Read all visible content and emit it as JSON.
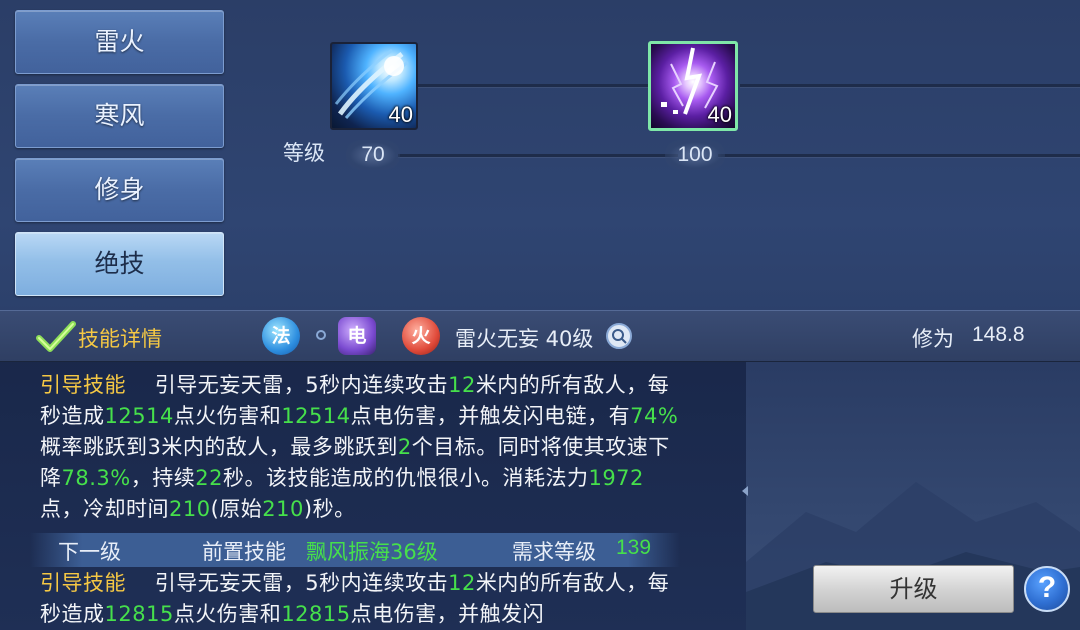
{
  "tabs": [
    {
      "label": "雷火",
      "active": false
    },
    {
      "label": "寒风",
      "active": false
    },
    {
      "label": "修身",
      "active": false
    },
    {
      "label": "绝技",
      "active": true
    }
  ],
  "skill_tree": {
    "level_label": "等级",
    "skills": [
      {
        "icon": "lightning-comet-skill-icon",
        "level": "40",
        "required_level": "70"
      },
      {
        "icon": "purple-lightning-skill-icon",
        "level": "40",
        "required_level": "100",
        "selected": true
      }
    ]
  },
  "header": {
    "title": "技能详情",
    "elements": [
      "法",
      "电",
      "火"
    ],
    "skill_name": "雷火无妄 40级",
    "cultivation_label": "修为",
    "cultivation_value": "148.8"
  },
  "current": {
    "type": "引导技能",
    "p1": "引导无妄天雷，5秒内连续攻击",
    "v1": "12",
    "p2": "米内的所有敌人，每秒造成",
    "v2": "12514",
    "p3": "点火伤害和",
    "v3": "12514",
    "p4": "点电伤害，并触发闪电链，有",
    "v4": "74%",
    "p5": "概率跳跃到3米内的敌人，最多跳跃到",
    "v5": "2",
    "p6": "个目标。同时将使其攻速下降",
    "v6": "78.3%",
    "p7": "，持续",
    "v7": "22",
    "p8": "秒。该技能造成的仇恨很小。消耗法力",
    "v8": "1972",
    "p9": "点，冷却时间",
    "v9": "210",
    "p10": "(原始",
    "v10": "210",
    "p11": ")秒。"
  },
  "next": {
    "label": "下一级",
    "prereq_label": "前置技能",
    "prereq_value": "飘风振海36级",
    "req_label": "需求等级",
    "req_value": "139"
  },
  "next_desc": {
    "type": "引导技能",
    "p1": "引导无妄天雷，5秒内连续攻击",
    "v1": "12",
    "p2": "米内的所有敌人，每秒造成",
    "v2": "12815",
    "p3": "点火伤害和",
    "v3": "12815",
    "p4": "点电伤害，并触发闪"
  },
  "buttons": {
    "upgrade": "升级",
    "help": "?"
  }
}
